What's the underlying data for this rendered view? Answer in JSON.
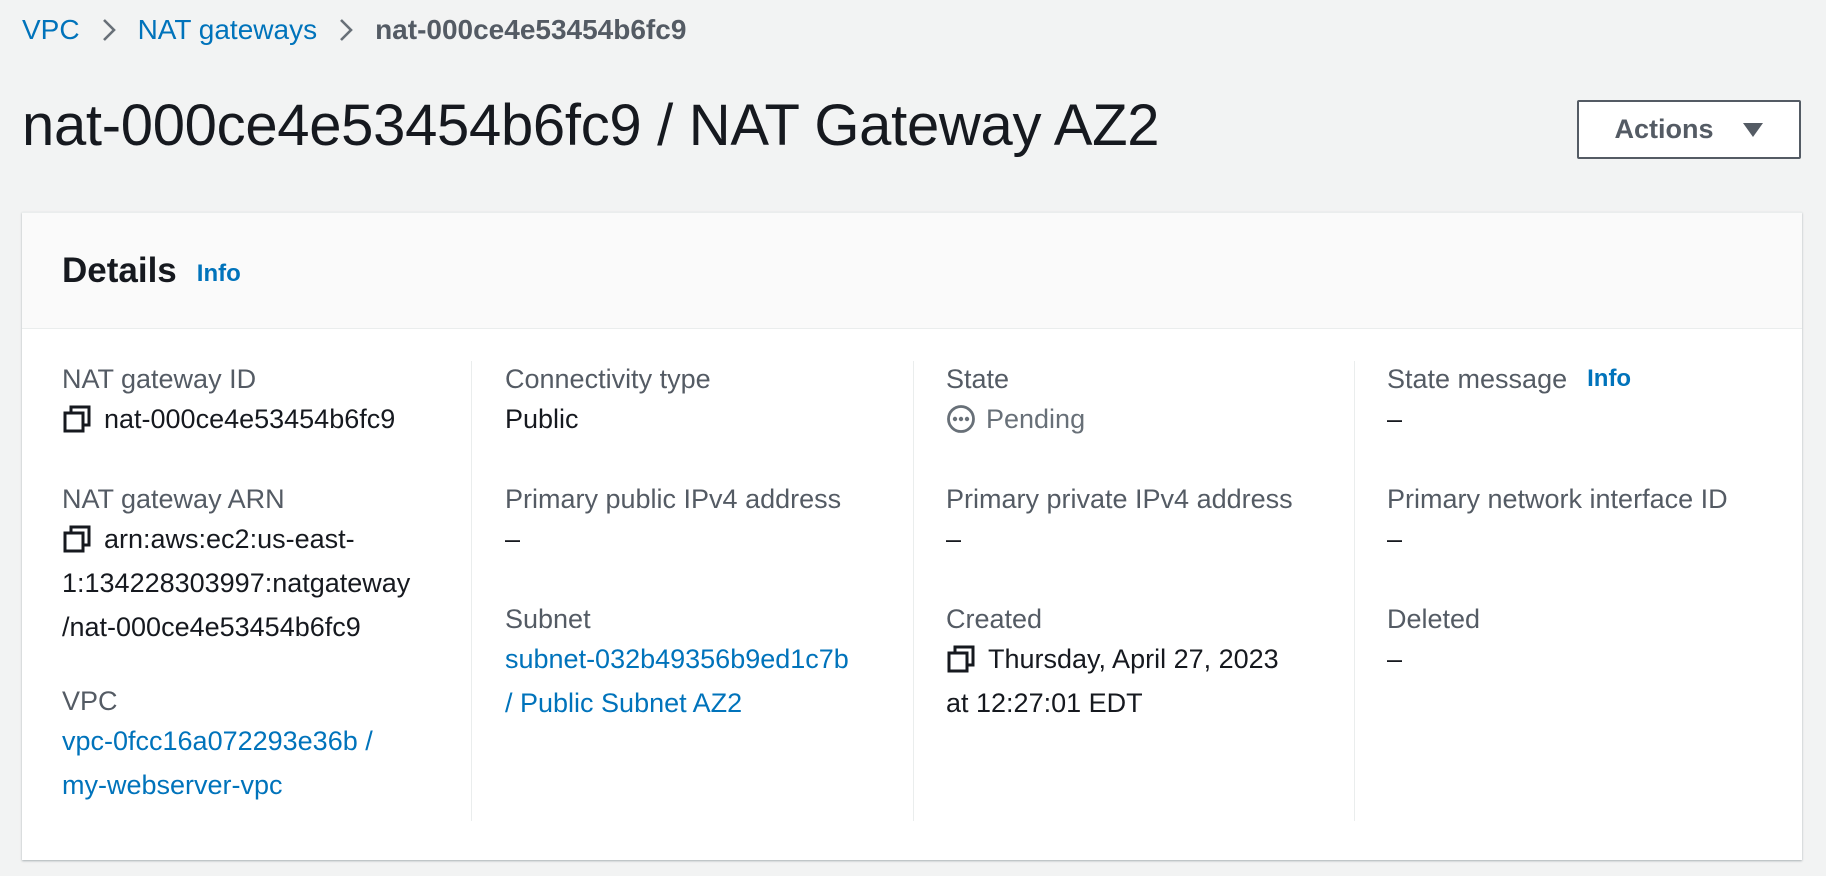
{
  "breadcrumb": {
    "items": [
      "VPC",
      "NAT gateways"
    ],
    "current": "nat-000ce4e53454b6fc9"
  },
  "header": {
    "title": "nat-000ce4e53454b6fc9 / NAT Gateway AZ2",
    "actions_label": "Actions"
  },
  "details": {
    "title": "Details",
    "info_label": "Info",
    "nat_gateway_id": {
      "label": "NAT gateway ID",
      "value": "nat-000ce4e53454b6fc9"
    },
    "nat_gateway_arn": {
      "label": "NAT gateway ARN",
      "lines": [
        "arn:aws:ec2:us-east-",
        "1:134228303997:natgateway",
        "/nat-000ce4e53454b6fc9"
      ]
    },
    "vpc": {
      "label": "VPC",
      "lines": [
        "vpc-0fcc16a072293e36b /",
        "my-webserver-vpc"
      ]
    },
    "connectivity_type": {
      "label": "Connectivity type",
      "value": "Public"
    },
    "primary_public_ipv4": {
      "label": "Primary public IPv4 address",
      "value": "–"
    },
    "subnet": {
      "label": "Subnet",
      "lines": [
        "subnet-032b49356b9ed1c7b",
        "/ Public Subnet AZ2"
      ]
    },
    "state": {
      "label": "State",
      "value": "Pending"
    },
    "primary_private_ipv4": {
      "label": "Primary private IPv4 address",
      "value": "–"
    },
    "created": {
      "label": "Created",
      "lines": [
        "Thursday, April 27, 2023",
        "at 12:27:01 EDT"
      ]
    },
    "state_message": {
      "label": "State message",
      "info_label": "Info",
      "value": "–"
    },
    "primary_network_interface": {
      "label": "Primary network interface ID",
      "value": "–"
    },
    "deleted": {
      "label": "Deleted",
      "value": "–"
    }
  },
  "icons": {
    "copy": "copy-icon",
    "pending": "status-pending-icon",
    "breadcrumb_separator": "chevron-right-icon",
    "actions_caret": "caret-down-icon"
  },
  "colors": {
    "link": "#0073bb",
    "text": "#16191f",
    "secondary_text": "#545b64",
    "page_background": "#f2f3f3"
  }
}
